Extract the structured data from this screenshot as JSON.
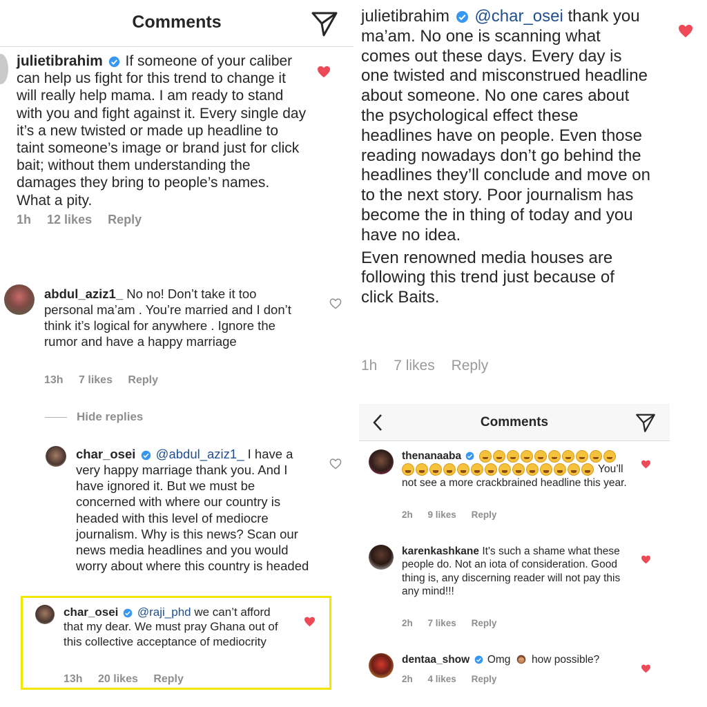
{
  "left": {
    "header_title": "Comments",
    "comments": [
      {
        "username": "julietibrahim",
        "verified": true,
        "text": "If someone of your caliber can help us fight for this trend to change it will really help mama. I am ready to stand with you and fight against it. Every single day it’s a new twisted or made up  headline to taint someone’s image or brand just for click bait; without them understanding the damages they bring to people’s names. What a pity.",
        "time": "1h",
        "likes": "12 likes",
        "reply": "Reply",
        "liked": true
      },
      {
        "username": "abdul_aziz1_",
        "verified": false,
        "text": "No no! Don’t take it too personal ma’am . You’re married and I don’t think it’s logical for anywhere . Ignore the rumor and have a happy marriage",
        "time": "13h",
        "likes": "7 likes",
        "reply": "Reply",
        "liked": false
      }
    ],
    "hide_replies": "Hide replies",
    "replies": [
      {
        "username": "char_osei",
        "verified": true,
        "mention": "@abdul_aziz1_",
        "text": "I have a very happy marriage thank you. And I have ignored it. But we must be concerned with where our country is headed with this level of mediocre journalism. Why is this news? Scan our news media headlines and you would worry about where this country is headed",
        "liked": false
      },
      {
        "username": "char_osei",
        "verified": true,
        "mention": "@raji_phd",
        "text": "we can’t afford that my dear. We must pray Ghana out of this collective acceptance of mediocrity",
        "time": "13h",
        "likes": "20 likes",
        "reply": "Reply",
        "liked": true
      }
    ]
  },
  "right_top": {
    "username": "julietibrahim",
    "verified": true,
    "mention": "@char_osei",
    "text": "thank you ma’am. No one is scanning what comes out these days. Every day is one twisted and misconstrued headline about someone. No one cares about the psychological effect these headlines have on people. Even those reading nowadays don’t go behind the headlines they’ll conclude and move on to the next story. Poor journalism has become the in thing of today and you have no idea.",
    "text2": "Even renowned media houses are following this trend just because of click Baits.",
    "time": "1h",
    "likes": "7 likes",
    "reply": "Reply",
    "liked": true
  },
  "right_bottom": {
    "header_title": "Comments",
    "comments": [
      {
        "username": "thenanaaba",
        "verified": true,
        "emoji_name": "face-with-tears-of-joy",
        "emoji_count": 24,
        "text": "You’ll not see a more crackbrained headline this year.",
        "time": "2h",
        "likes": "9 likes",
        "reply": "Reply",
        "liked": true
      },
      {
        "username": "karenkashkane",
        "verified": false,
        "text": "It's such a shame what these people do. Not an iota of consideration. Good thing is, any discerning reader will not pay this any mind!!!",
        "time": "2h",
        "likes": "7 likes",
        "reply": "Reply",
        "liked": true
      },
      {
        "username": "dentaa_show",
        "verified": true,
        "text_a": "Omg",
        "emoji_name": "woman-facepalming",
        "text_b": "how possible?",
        "time": "2h",
        "likes": "4 likes",
        "reply": "Reply",
        "liked": true
      }
    ]
  },
  "colors": {
    "heart_red": "#ed4956",
    "verified_blue": "#3897f0",
    "mention_blue": "#1f4f8f",
    "meta_gray": "#8e8e8e",
    "highlight_yellow": "#f2e600"
  }
}
